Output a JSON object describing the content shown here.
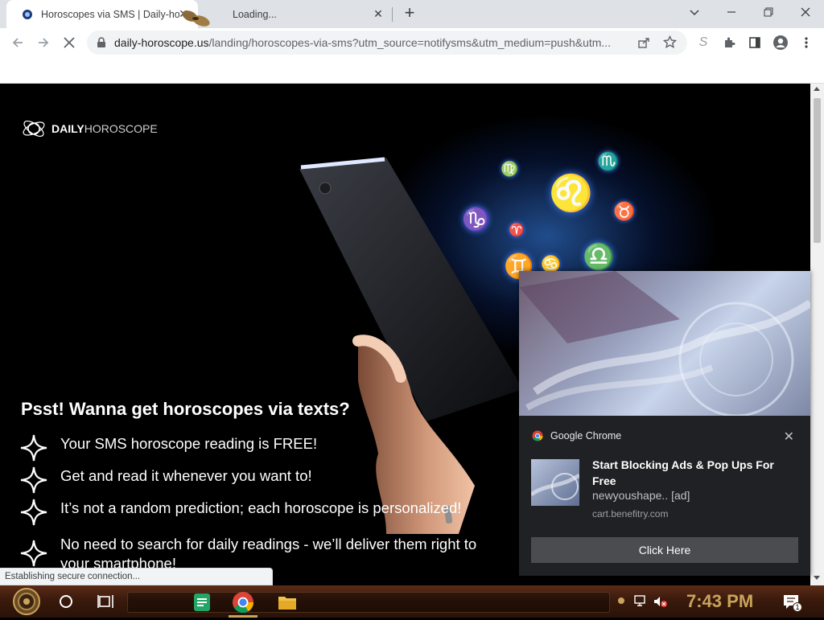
{
  "browser": {
    "tabs": [
      {
        "title": "Horoscopes via SMS | Daily-ho",
        "active": true
      },
      {
        "title": "Loading...",
        "active": false
      }
    ],
    "address": {
      "host": "daily-horoscope.us",
      "path": "/landing/horoscopes-via-sms?utm_source=notifysms&utm_medium=push&utm..."
    },
    "status_text": "Establishing secure connection..."
  },
  "page": {
    "logo_bold": "DAILY",
    "logo_light": "HOROSCOPE",
    "headline": "Psst! Wanna get horoscopes via texts?",
    "features": [
      "Your SMS horoscope reading is FREE!",
      "Get and read it whenever you want to!",
      "It’s not a random prediction; each horoscope is personalized!",
      "No need to search for daily readings - we’ll deliver them right to your smartphone!"
    ],
    "zodiac_glyphs": [
      "♍",
      "♏",
      "♌",
      "♑",
      "♉",
      "♈",
      "♊",
      "♋",
      "♎"
    ]
  },
  "notification": {
    "source": "Google Chrome",
    "title": "Start Blocking Ads & Pop Ups For Free",
    "subtitle": "newyoushape.. [ad]",
    "domain": "cart.benefitry.com",
    "button": "Click Here"
  },
  "taskbar": {
    "clock": "7:43 PM",
    "notification_count": "1"
  },
  "colors": {
    "accent_blue": "#4f8cff",
    "clock_gold": "#c9a45c",
    "taskbar_brown": "#3a1a0c"
  }
}
